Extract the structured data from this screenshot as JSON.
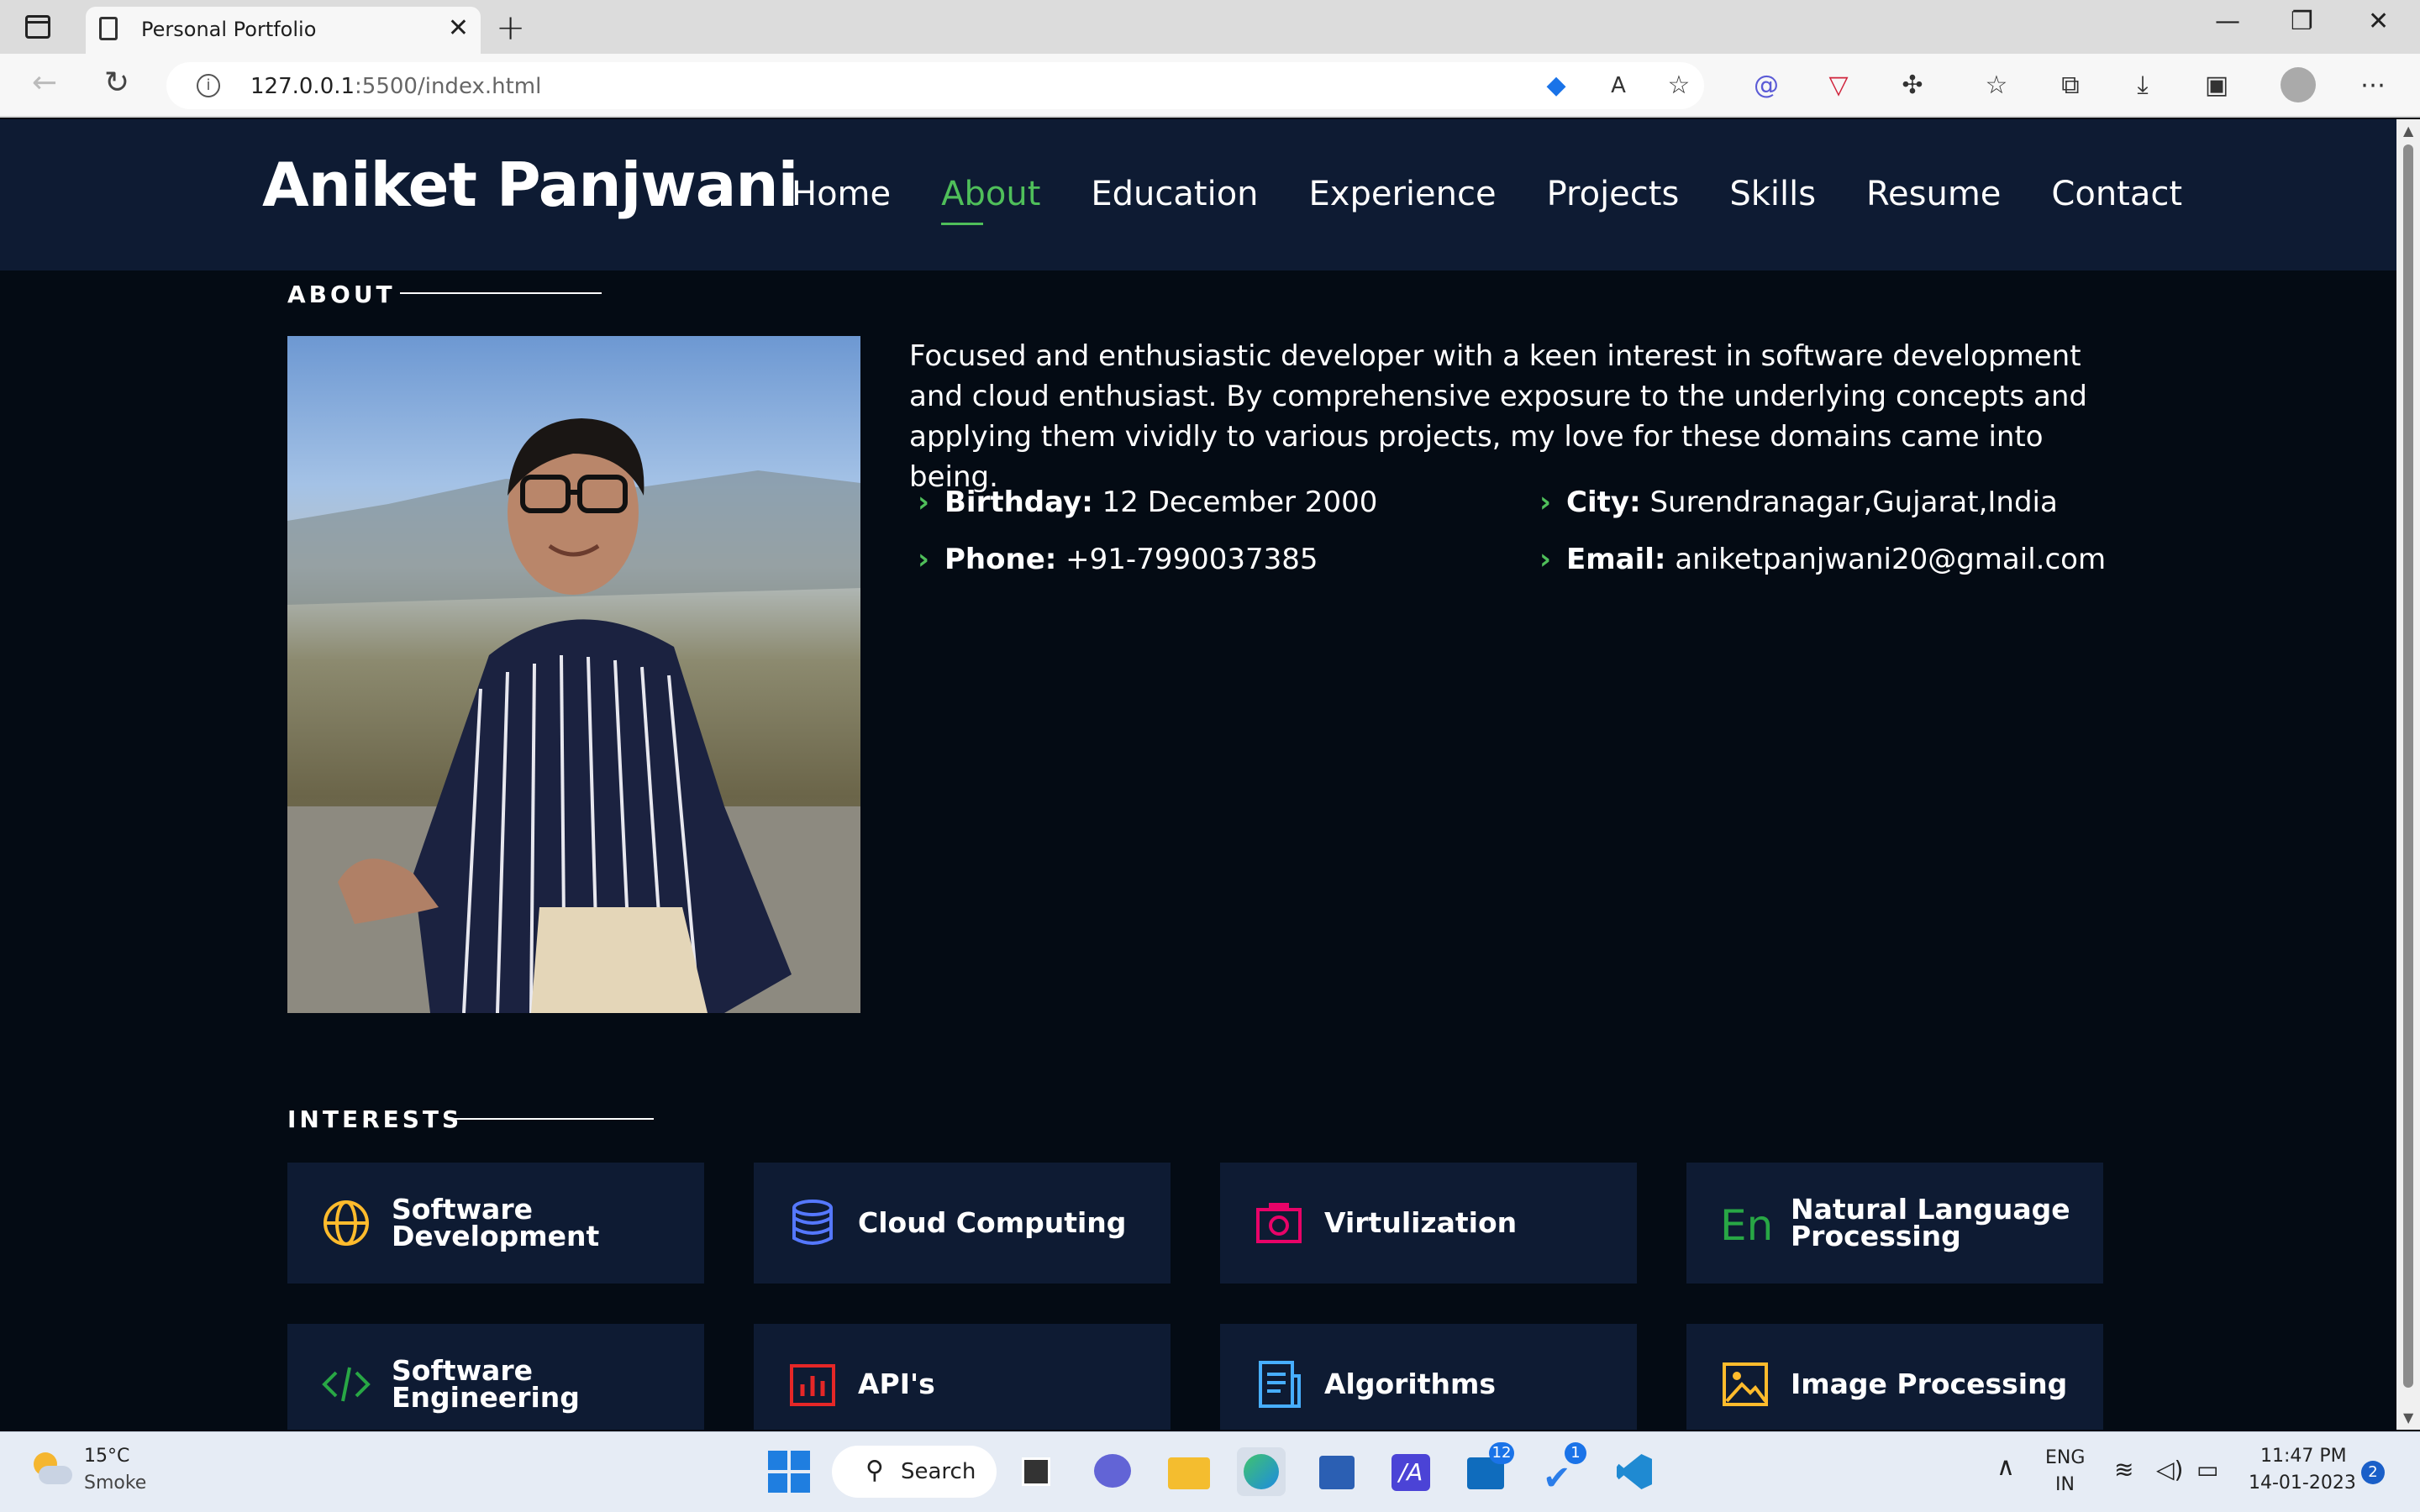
{
  "browser": {
    "tab_title": "Personal Portfolio",
    "url_host": "127.0.0.1",
    "url_rest": ":5500/index.html"
  },
  "site": {
    "logo": "Aniket Panjwani",
    "nav": [
      "Home",
      "About",
      "Education",
      "Experience",
      "Projects",
      "Skills",
      "Resume",
      "Contact"
    ],
    "active_nav": "About",
    "accent": "#4fbf5a"
  },
  "about": {
    "section_title": "ABOUT",
    "bio": "Focused and enthusiastic developer with a keen interest in software development and cloud enthusiast. By comprehensive exposure to the underlying concepts and applying them vividly to various projects, my love for these domains came into being.",
    "details": [
      {
        "label": "Birthday:",
        "value": " 12 December 2000"
      },
      {
        "label": "City:",
        "value": " Surendranagar,Gujarat,India"
      },
      {
        "label": "Phone:",
        "value": " +91-7990037385"
      },
      {
        "label": "Email:",
        "value": " aniketpanjwani20@gmail.com"
      }
    ]
  },
  "interests": {
    "section_title": "INTERESTS",
    "items": [
      {
        "line1": "Software",
        "line2": "Development",
        "icon": "globe-icon",
        "color": "#ffbb2c"
      },
      {
        "line1": "Cloud Computing",
        "line2": "",
        "icon": "database-icon",
        "color": "#5578ff"
      },
      {
        "line1": "Virtulization",
        "line2": "",
        "icon": "camera-icon",
        "color": "#e80368"
      },
      {
        "line1": "Natural Language",
        "line2": "Processing",
        "icon": "en-icon",
        "color": "#28a745"
      },
      {
        "line1": "Software",
        "line2": "Engineering",
        "icon": "code-icon",
        "color": "#28a745"
      },
      {
        "line1": "API's",
        "line2": "",
        "icon": "bar-chart-icon",
        "color": "#e52727"
      },
      {
        "line1": "Algorithms",
        "line2": "",
        "icon": "document-icon",
        "color": "#47aeff"
      },
      {
        "line1": "Image Processing",
        "line2": "",
        "icon": "image-icon",
        "color": "#ffbb2c"
      }
    ]
  },
  "taskbar": {
    "weather_temp": "15°C",
    "weather_desc": "Smoke",
    "search": "Search",
    "lang1": "ENG",
    "lang2": "IN",
    "time": "11:47 PM",
    "date": "14-01-2023",
    "notif": "2",
    "badge_mail": "12",
    "badge_todo": "1"
  }
}
